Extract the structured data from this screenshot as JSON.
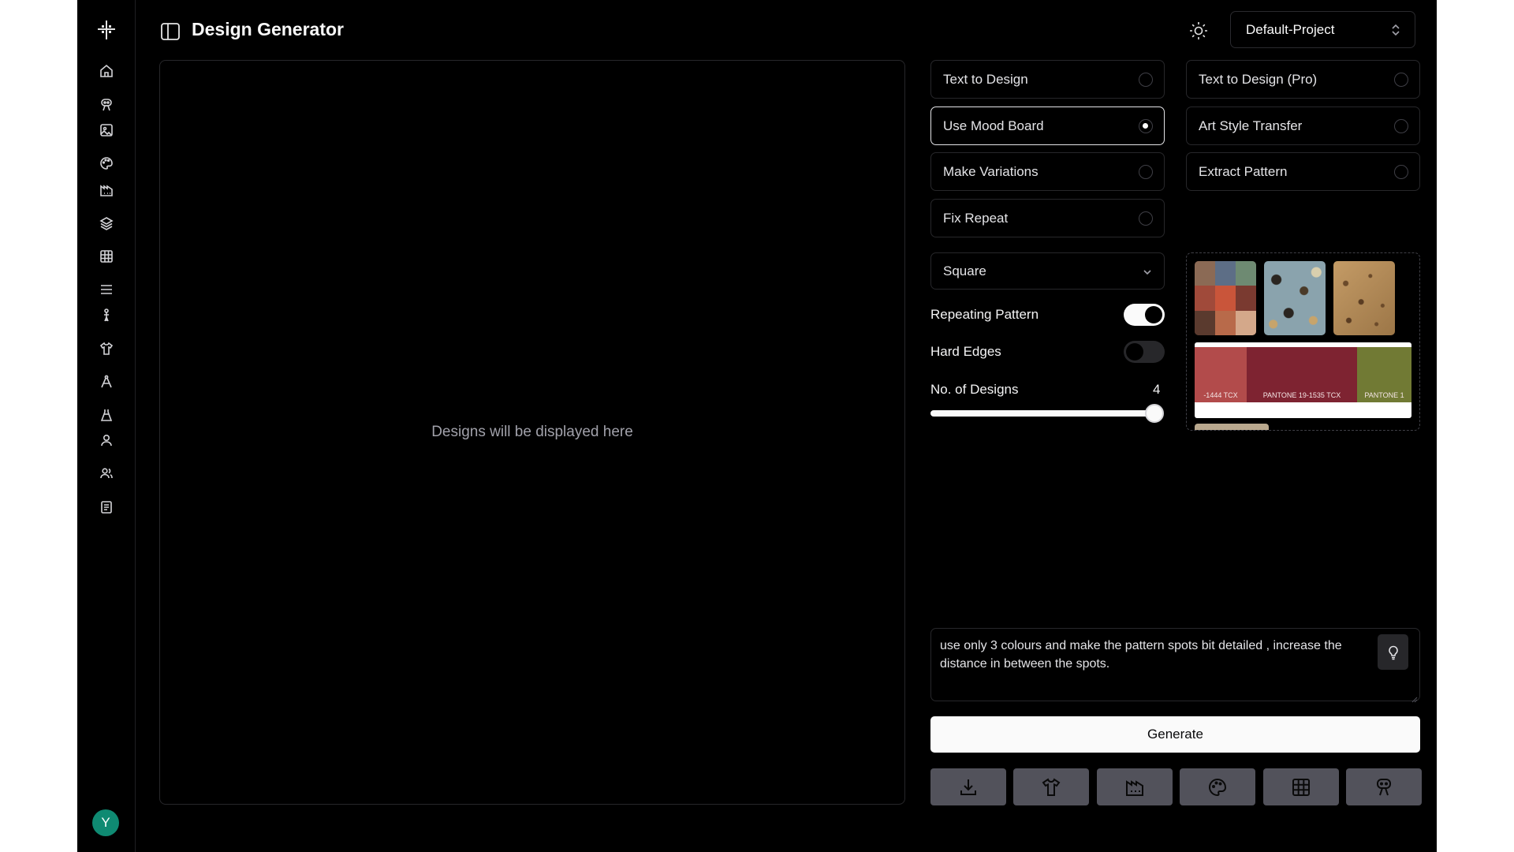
{
  "header": {
    "title": "Design Generator",
    "project": "Default-Project"
  },
  "sidebar": {
    "items": [
      {
        "name": "home-icon"
      },
      {
        "name": "robot-icon"
      },
      {
        "name": "image-icon"
      },
      {
        "name": "palette-icon"
      },
      {
        "name": "factory-icon"
      },
      {
        "name": "layers-icon"
      },
      {
        "name": "grid-icon"
      },
      {
        "name": "menu-icon"
      },
      {
        "name": "model-figure-icon"
      },
      {
        "name": "shirt-icon"
      },
      {
        "name": "compass-icon"
      },
      {
        "name": "dress-icon"
      },
      {
        "name": "user-icon"
      },
      {
        "name": "users-icon"
      },
      {
        "name": "document-icon"
      }
    ],
    "avatar_initial": "Y"
  },
  "display": {
    "placeholder": "Designs will be displayed here"
  },
  "modes": [
    {
      "label": "Text to Design",
      "selected": false
    },
    {
      "label": "Text to Design (Pro)",
      "selected": false
    },
    {
      "label": "Use Mood Board",
      "selected": true
    },
    {
      "label": "Art Style Transfer",
      "selected": false
    },
    {
      "label": "Make Variations",
      "selected": false
    },
    {
      "label": "Extract Pattern",
      "selected": false
    },
    {
      "label": "Fix Repeat",
      "selected": false
    }
  ],
  "settings": {
    "shape": "Square",
    "repeating_pattern": {
      "label": "Repeating Pattern",
      "on": true
    },
    "hard_edges": {
      "label": "Hard Edges",
      "on": false
    },
    "num_designs": {
      "label": "No. of Designs",
      "value": "4",
      "fraction": 1.0
    }
  },
  "moodboard": {
    "palette": [
      {
        "label": "-1444 TCX",
        "color": "#b24b4b"
      },
      {
        "label": "PANTONE 19-1535 TCX",
        "color": "#7e2331"
      },
      {
        "label": "PANTONE 1",
        "color": "#717a34"
      }
    ]
  },
  "prompt": {
    "text": "use only 3 colours and make the pattern spots bit detailed , increase the distance in between the spots."
  },
  "generate_label": "Generate",
  "tools": [
    {
      "name": "download-icon"
    },
    {
      "name": "shirt-icon"
    },
    {
      "name": "factory-icon"
    },
    {
      "name": "palette-icon"
    },
    {
      "name": "grid-icon"
    },
    {
      "name": "robot-icon"
    }
  ],
  "colors": {
    "background": "#000000",
    "border": "#27272a",
    "avatar": "#0f8a72",
    "tool_button": "#52525b"
  }
}
